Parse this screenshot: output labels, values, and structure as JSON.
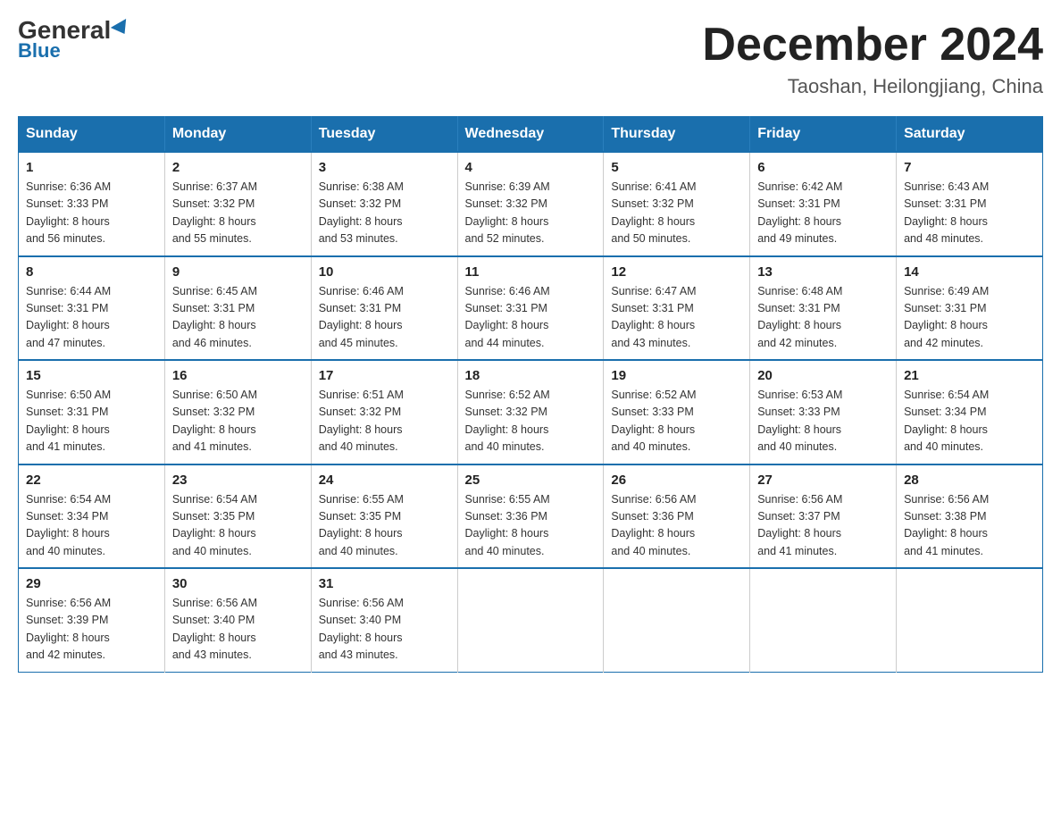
{
  "header": {
    "logo_general": "General",
    "logo_blue": "Blue",
    "main_title": "December 2024",
    "subtitle": "Taoshan, Heilongjiang, China"
  },
  "days_of_week": [
    "Sunday",
    "Monday",
    "Tuesday",
    "Wednesday",
    "Thursday",
    "Friday",
    "Saturday"
  ],
  "weeks": [
    [
      {
        "day": "1",
        "sunrise": "6:36 AM",
        "sunset": "3:33 PM",
        "daylight": "8 hours and 56 minutes."
      },
      {
        "day": "2",
        "sunrise": "6:37 AM",
        "sunset": "3:32 PM",
        "daylight": "8 hours and 55 minutes."
      },
      {
        "day": "3",
        "sunrise": "6:38 AM",
        "sunset": "3:32 PM",
        "daylight": "8 hours and 53 minutes."
      },
      {
        "day": "4",
        "sunrise": "6:39 AM",
        "sunset": "3:32 PM",
        "daylight": "8 hours and 52 minutes."
      },
      {
        "day": "5",
        "sunrise": "6:41 AM",
        "sunset": "3:32 PM",
        "daylight": "8 hours and 50 minutes."
      },
      {
        "day": "6",
        "sunrise": "6:42 AM",
        "sunset": "3:31 PM",
        "daylight": "8 hours and 49 minutes."
      },
      {
        "day": "7",
        "sunrise": "6:43 AM",
        "sunset": "3:31 PM",
        "daylight": "8 hours and 48 minutes."
      }
    ],
    [
      {
        "day": "8",
        "sunrise": "6:44 AM",
        "sunset": "3:31 PM",
        "daylight": "8 hours and 47 minutes."
      },
      {
        "day": "9",
        "sunrise": "6:45 AM",
        "sunset": "3:31 PM",
        "daylight": "8 hours and 46 minutes."
      },
      {
        "day": "10",
        "sunrise": "6:46 AM",
        "sunset": "3:31 PM",
        "daylight": "8 hours and 45 minutes."
      },
      {
        "day": "11",
        "sunrise": "6:46 AM",
        "sunset": "3:31 PM",
        "daylight": "8 hours and 44 minutes."
      },
      {
        "day": "12",
        "sunrise": "6:47 AM",
        "sunset": "3:31 PM",
        "daylight": "8 hours and 43 minutes."
      },
      {
        "day": "13",
        "sunrise": "6:48 AM",
        "sunset": "3:31 PM",
        "daylight": "8 hours and 42 minutes."
      },
      {
        "day": "14",
        "sunrise": "6:49 AM",
        "sunset": "3:31 PM",
        "daylight": "8 hours and 42 minutes."
      }
    ],
    [
      {
        "day": "15",
        "sunrise": "6:50 AM",
        "sunset": "3:31 PM",
        "daylight": "8 hours and 41 minutes."
      },
      {
        "day": "16",
        "sunrise": "6:50 AM",
        "sunset": "3:32 PM",
        "daylight": "8 hours and 41 minutes."
      },
      {
        "day": "17",
        "sunrise": "6:51 AM",
        "sunset": "3:32 PM",
        "daylight": "8 hours and 40 minutes."
      },
      {
        "day": "18",
        "sunrise": "6:52 AM",
        "sunset": "3:32 PM",
        "daylight": "8 hours and 40 minutes."
      },
      {
        "day": "19",
        "sunrise": "6:52 AM",
        "sunset": "3:33 PM",
        "daylight": "8 hours and 40 minutes."
      },
      {
        "day": "20",
        "sunrise": "6:53 AM",
        "sunset": "3:33 PM",
        "daylight": "8 hours and 40 minutes."
      },
      {
        "day": "21",
        "sunrise": "6:54 AM",
        "sunset": "3:34 PM",
        "daylight": "8 hours and 40 minutes."
      }
    ],
    [
      {
        "day": "22",
        "sunrise": "6:54 AM",
        "sunset": "3:34 PM",
        "daylight": "8 hours and 40 minutes."
      },
      {
        "day": "23",
        "sunrise": "6:54 AM",
        "sunset": "3:35 PM",
        "daylight": "8 hours and 40 minutes."
      },
      {
        "day": "24",
        "sunrise": "6:55 AM",
        "sunset": "3:35 PM",
        "daylight": "8 hours and 40 minutes."
      },
      {
        "day": "25",
        "sunrise": "6:55 AM",
        "sunset": "3:36 PM",
        "daylight": "8 hours and 40 minutes."
      },
      {
        "day": "26",
        "sunrise": "6:56 AM",
        "sunset": "3:36 PM",
        "daylight": "8 hours and 40 minutes."
      },
      {
        "day": "27",
        "sunrise": "6:56 AM",
        "sunset": "3:37 PM",
        "daylight": "8 hours and 41 minutes."
      },
      {
        "day": "28",
        "sunrise": "6:56 AM",
        "sunset": "3:38 PM",
        "daylight": "8 hours and 41 minutes."
      }
    ],
    [
      {
        "day": "29",
        "sunrise": "6:56 AM",
        "sunset": "3:39 PM",
        "daylight": "8 hours and 42 minutes."
      },
      {
        "day": "30",
        "sunrise": "6:56 AM",
        "sunset": "3:40 PM",
        "daylight": "8 hours and 43 minutes."
      },
      {
        "day": "31",
        "sunrise": "6:56 AM",
        "sunset": "3:40 PM",
        "daylight": "8 hours and 43 minutes."
      },
      null,
      null,
      null,
      null
    ]
  ],
  "labels": {
    "sunrise": "Sunrise:",
    "sunset": "Sunset:",
    "daylight": "Daylight:"
  }
}
